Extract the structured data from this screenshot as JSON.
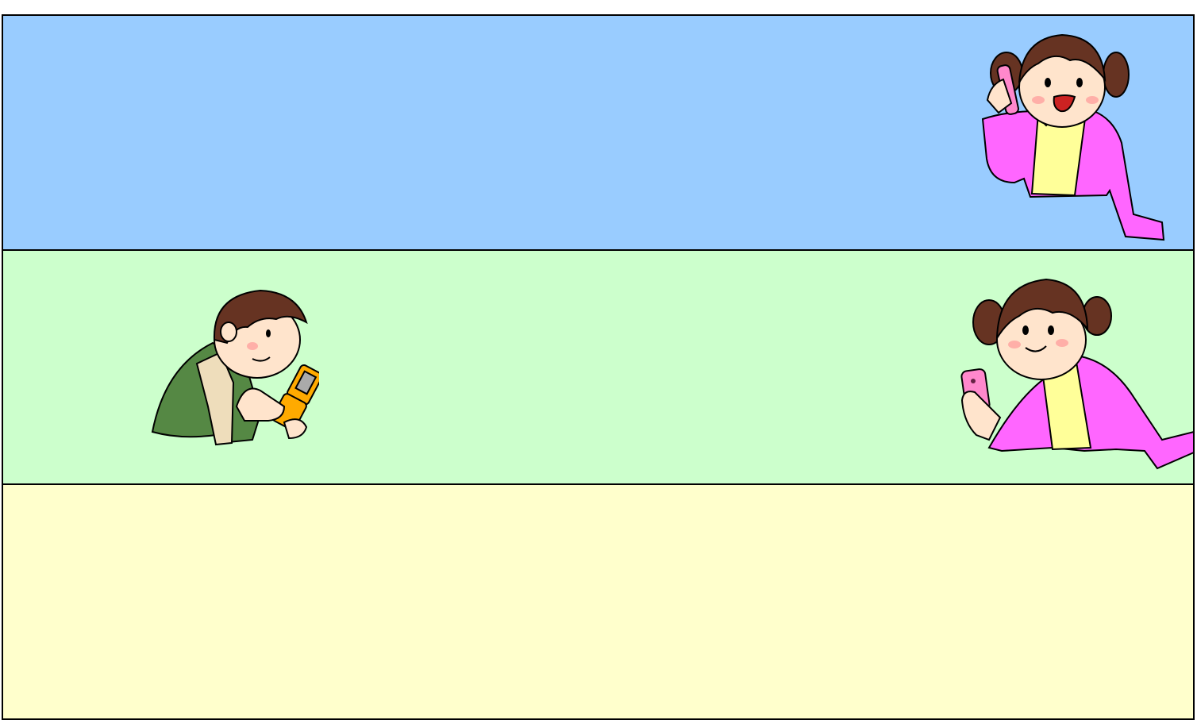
{
  "colors": {
    "panel_top": "#99ccff",
    "panel_middle": "#ccffcc",
    "panel_bottom": "#ffffcc",
    "border": "#000000",
    "jacket_pink": "#ff66ff",
    "shirt_yellow": "#ffff99",
    "hair_brown": "#663322",
    "skin": "#ffe4cc",
    "boy_shirt_green": "#558844",
    "boy_shirt_beige": "#eeddbb",
    "phone_orange": "#ffaa00",
    "phone_pink": "#ff88cc"
  },
  "panels": [
    {
      "name": "top",
      "figures": [
        "girl-talking-on-phone"
      ]
    },
    {
      "name": "middle",
      "figures": [
        "boy-texting-on-flip-phone",
        "girl-holding-phone"
      ]
    },
    {
      "name": "bottom",
      "figures": []
    }
  ]
}
